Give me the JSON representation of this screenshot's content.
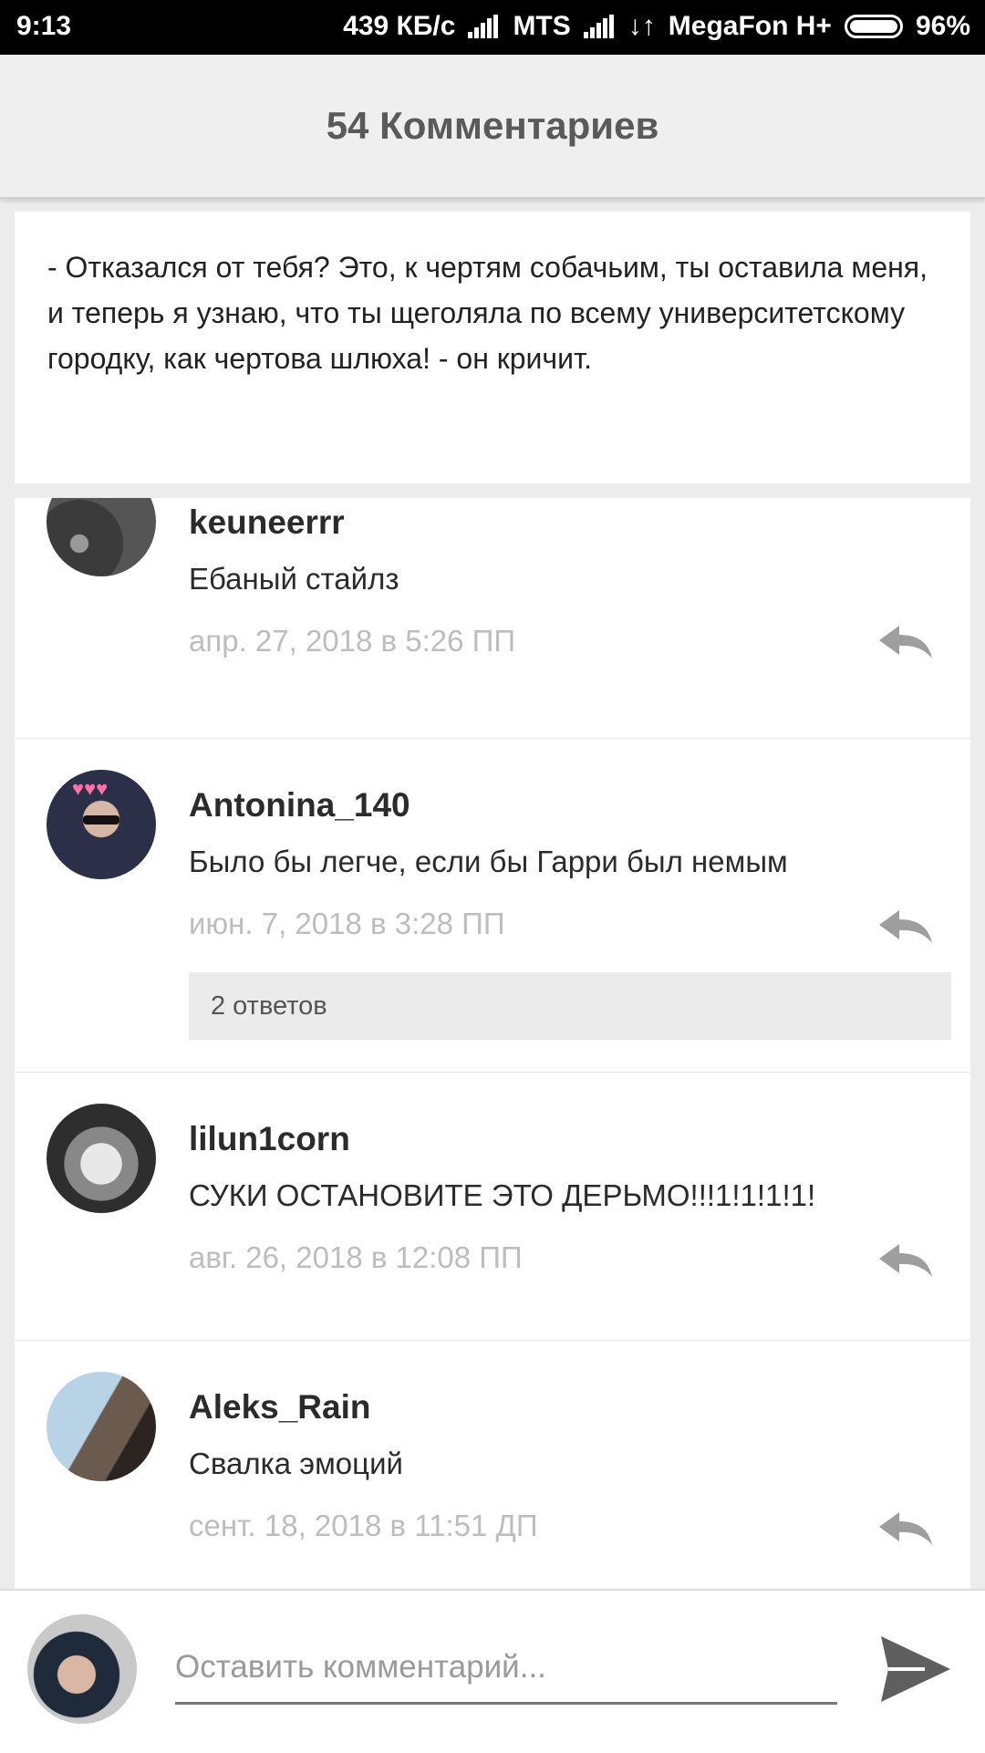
{
  "status_bar": {
    "time": "9:13",
    "speed": "439 КБ/с",
    "carrier1": "MTS",
    "carrier2": "MegaFon H+",
    "battery": "96%"
  },
  "header": {
    "title": "54 Комментариев"
  },
  "quote": {
    "text": "- Отказался от тебя? Это, к чертям собачьим, ты оставила меня, и теперь я узнаю, что ты щеголяла по всему университетскому городку, как чертова шлюха! - он кричит."
  },
  "comments": [
    {
      "username": "keuneerrr",
      "text": "Ебаный стайлз",
      "date": "апр. 27, 2018 в 5:26 ПП"
    },
    {
      "username": "Antonina_140",
      "text": "Было бы легче, если бы Гарри был немым",
      "date": "июн. 7, 2018 в 3:28 ПП",
      "replies": "2 ответов"
    },
    {
      "username": "lilun1corn",
      "text": "СУКИ ОСТАНОВИТЕ ЭТО ДЕРЬМО!!!1!1!1!1!",
      "date": "авг. 26, 2018 в 12:08 ПП"
    },
    {
      "username": "Aleks_Rain",
      "text": "Свалка эмоций",
      "date": "сент. 18, 2018 в 11:51 ДП"
    }
  ],
  "input": {
    "placeholder": "Оставить комментарий..."
  },
  "icons": {
    "reply": "reply-arrow-icon",
    "send": "send-icon"
  },
  "colors": {
    "header_bg": "#efefef",
    "text": "#2b2b2b",
    "date": "#bdbdbd",
    "icon": "#9e9e9e"
  }
}
